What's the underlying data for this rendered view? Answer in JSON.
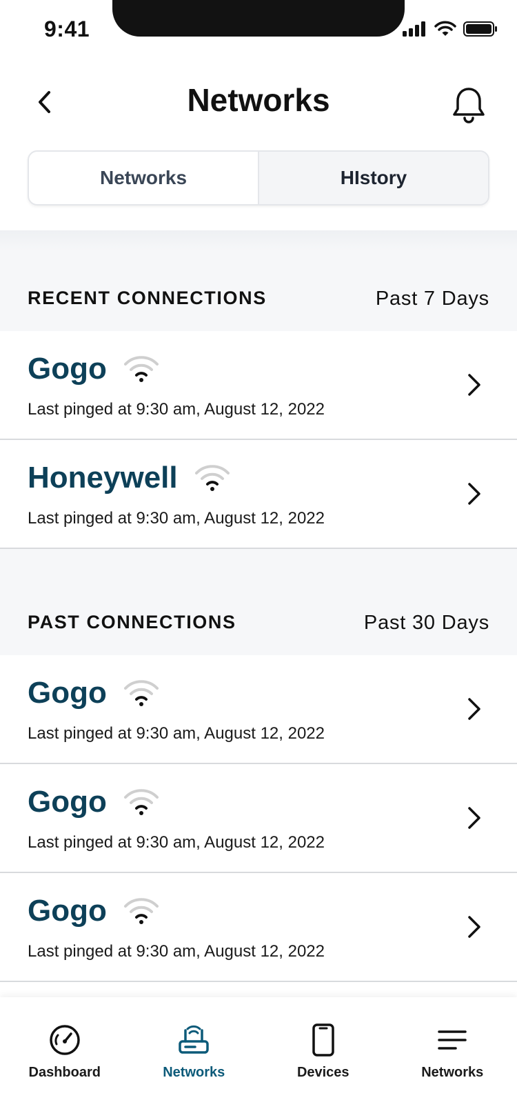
{
  "status_bar": {
    "time": "9:41"
  },
  "header": {
    "title": "Networks"
  },
  "segments": [
    {
      "label": "Networks",
      "active": false
    },
    {
      "label": "HIstory",
      "active": true
    }
  ],
  "recent": {
    "title": "RECENT CONNECTIONS",
    "range": "Past 7 Days",
    "items": [
      {
        "name": "Gogo",
        "subtitle": "Last pinged at 9:30 am, August 12, 2022"
      },
      {
        "name": "Honeywell",
        "subtitle": "Last pinged at 9:30 am, August 12, 2022"
      }
    ]
  },
  "past": {
    "title": "PAST CONNECTIONS",
    "range": "Past 30 Days",
    "items": [
      {
        "name": "Gogo",
        "subtitle": "Last pinged at 9:30 am, August 12, 2022"
      },
      {
        "name": "Gogo",
        "subtitle": "Last pinged at 9:30 am, August 12, 2022"
      },
      {
        "name": "Gogo",
        "subtitle": "Last pinged at 9:30 am, August 12, 2022"
      }
    ]
  },
  "tabbar": {
    "items": [
      {
        "label": "Dashboard",
        "icon": "speedometer-icon",
        "active": false
      },
      {
        "label": "Networks",
        "icon": "router-icon",
        "active": true
      },
      {
        "label": "Devices",
        "icon": "phone-icon",
        "active": false
      },
      {
        "label": "Networks",
        "icon": "menu-icon",
        "active": false
      }
    ]
  },
  "colors": {
    "accent": "#0c5a79",
    "network_name": "#0d4058",
    "section_bg": "#f6f7f9"
  }
}
